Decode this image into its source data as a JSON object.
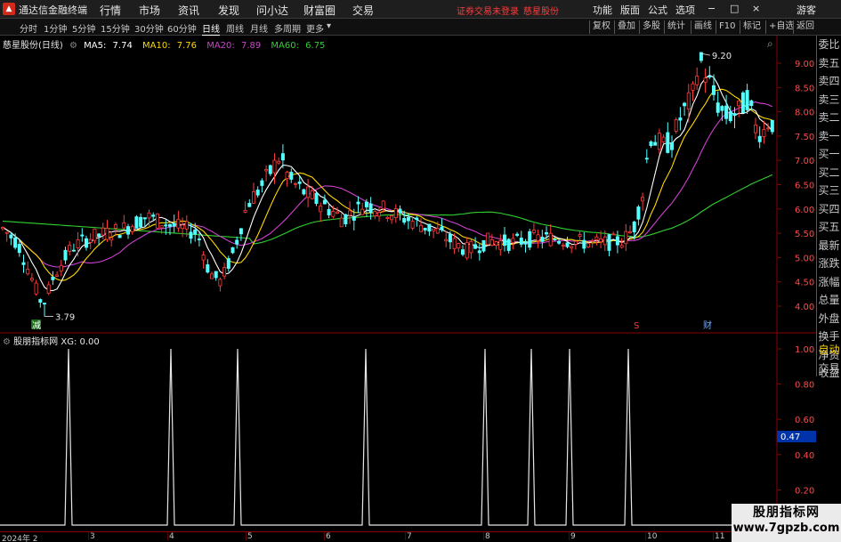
{
  "app": {
    "logo_glyph": "▲",
    "name": "通达信金融终端",
    "menus": [
      "行情",
      "市场",
      "资讯",
      "发现",
      "问小达",
      "财富圈",
      "交易"
    ],
    "login_warning": "证券交易未登录",
    "stock_title": "慈星股份",
    "right_menus": [
      "功能",
      "版面",
      "公式",
      "选项"
    ],
    "window_controls": [
      "−",
      "□",
      "×"
    ],
    "user": "游客"
  },
  "toolbar": {
    "periods": [
      "分时",
      "1分钟",
      "5分钟",
      "15分钟",
      "30分钟",
      "60分钟",
      "日线",
      "周线",
      "月线",
      "多周期",
      "更多"
    ],
    "active_period": "日线",
    "more_glyph": "▾",
    "right_buttons": [
      "复权",
      "叠加",
      "多股",
      "统计",
      "画线",
      "F10",
      "标记",
      "+自选",
      "返回"
    ],
    "search_glyph": "⌕",
    "settings_glyph": "⚙"
  },
  "main_panel": {
    "stock_label": "慈星股份(日线)",
    "ma": [
      {
        "label": "MA5:",
        "value": "7.74",
        "color": "#ffffff"
      },
      {
        "label": "MA10:",
        "value": "7.76",
        "color": "#ffd700"
      },
      {
        "label": "MA20:",
        "value": "7.89",
        "color": "#d040d0"
      },
      {
        "label": "MA60:",
        "value": "6.75",
        "color": "#30d030"
      }
    ],
    "price_axis": [
      "9.00",
      "8.50",
      "8.00",
      "7.50",
      "7.00",
      "6.50",
      "6.00",
      "5.50",
      "5.00",
      "4.50",
      "4.00"
    ],
    "high_label": "9.20",
    "low_label": "3.79",
    "marker_reduce": "减",
    "marker_s": "S",
    "marker_cai": "财"
  },
  "sub_panel": {
    "indicator": "股朋指标网",
    "value_label": "XG:",
    "value": "0.00",
    "axis": [
      "1.00",
      "0.80",
      "0.60",
      "0.40",
      "0.20"
    ],
    "cursor_value": "0.47",
    "spike_count": 10
  },
  "right_panel": {
    "items": [
      "委比",
      "卖五",
      "卖四",
      "卖三",
      "卖二",
      "卖一",
      "买一",
      "买二",
      "买三",
      "买四",
      "买五",
      "最新",
      "涨跌",
      "涨幅",
      "总量",
      "外盘",
      "换手",
      "净资",
      "收益"
    ],
    "bottom_items": [
      "自动",
      "交易"
    ]
  },
  "date_axis": [
    "2024年 2",
    "3",
    "4",
    "5",
    "6",
    "7",
    "8",
    "9",
    "10",
    "11"
  ],
  "watermark": {
    "line1": "股朋指标网",
    "line2": "www.7gpzb.com"
  },
  "chart_data": {
    "type": "candlestick",
    "title": "慈星股份(日线)",
    "ylim": [
      3.6,
      9.4
    ],
    "series": [
      {
        "name": "MA5",
        "last": 7.74
      },
      {
        "name": "MA10",
        "last": 7.76
      },
      {
        "name": "MA20",
        "last": 7.89
      },
      {
        "name": "MA60",
        "last": 6.75
      }
    ],
    "annotations": {
      "high": 9.2,
      "low": 3.79
    },
    "indicator": {
      "name": "XG",
      "ylim": [
        0,
        1
      ],
      "spike_value": 1.0,
      "baseline": 0.0
    }
  }
}
